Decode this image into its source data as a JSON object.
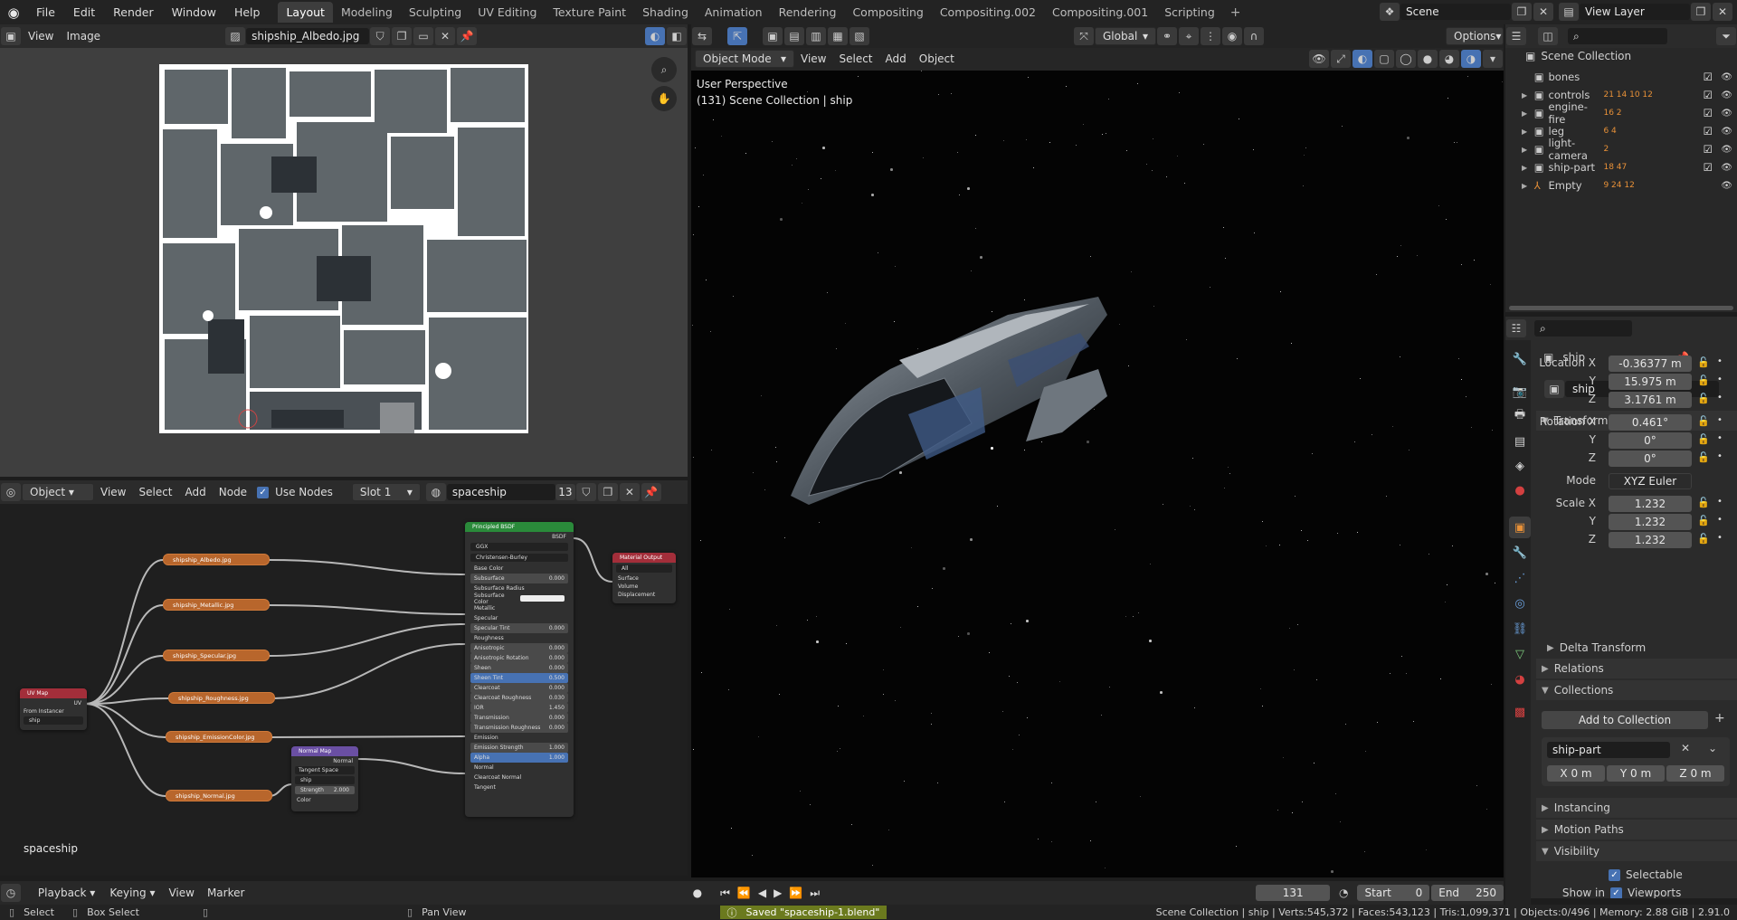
{
  "topbar": {
    "menus": [
      "File",
      "Edit",
      "Render",
      "Window",
      "Help"
    ],
    "workspaces": [
      "Layout",
      "Modeling",
      "Sculpting",
      "UV Editing",
      "Texture Paint",
      "Shading",
      "Animation",
      "Rendering",
      "Compositing",
      "Compositing.002",
      "Compositing.001",
      "Scripting"
    ],
    "active_workspace": "Layout",
    "scene": "Scene",
    "view_layer": "View Layer"
  },
  "image_editor": {
    "menus": [
      "View",
      "Image"
    ],
    "image_name": "shipship_Albedo.jpg"
  },
  "node_editor": {
    "object_type": "Object",
    "menus": [
      "View",
      "Select",
      "Add",
      "Node"
    ],
    "use_nodes_label": "Use Nodes",
    "slot": "Slot 1",
    "material": "spaceship",
    "user_count": "13",
    "footer_label": "spaceship",
    "textures": [
      "shipship_Albedo.jpg",
      "shipship_Metallic.jpg",
      "shipship_Specular.jpg",
      "shipship_Roughness.jpg",
      "shipship_EmissionColor.jpg",
      "shipship_Normal.jpg"
    ],
    "uvmap": {
      "title": "UV Map",
      "out": "UV",
      "from_instancer": "From Instancer",
      "map": "ship"
    },
    "normalmap": {
      "title": "Normal Map",
      "out": "Normal",
      "space": "Tangent Space",
      "map": "ship",
      "strength_label": "Strength",
      "strength": "2.000",
      "color": "Color"
    },
    "bsdf": {
      "title": "Principled BSDF",
      "out": "BSDF",
      "dist": "GGX",
      "sss": "Christensen-Burley",
      "rows": [
        [
          "Base Color",
          ""
        ],
        [
          "Subsurface",
          "0.000"
        ],
        [
          "Subsurface Radius",
          ""
        ],
        [
          "Subsurface Color",
          ""
        ],
        [
          "Metallic",
          ""
        ],
        [
          "Specular",
          ""
        ],
        [
          "Specular Tint",
          "0.000"
        ],
        [
          "Roughness",
          ""
        ],
        [
          "Anisotropic",
          "0.000"
        ],
        [
          "Anisotropic Rotation",
          "0.000"
        ],
        [
          "Sheen",
          "0.000"
        ],
        [
          "Sheen Tint",
          "0.500"
        ],
        [
          "Clearcoat",
          "0.000"
        ],
        [
          "Clearcoat Roughness",
          "0.030"
        ],
        [
          "IOR",
          "1.450"
        ],
        [
          "Transmission",
          "0.000"
        ],
        [
          "Transmission Roughness",
          "0.000"
        ],
        [
          "Emission",
          ""
        ],
        [
          "Emission Strength",
          "1.000"
        ],
        [
          "Alpha",
          "1.000"
        ],
        [
          "Normal",
          ""
        ],
        [
          "Clearcoat Normal",
          ""
        ],
        [
          "Tangent",
          ""
        ]
      ]
    },
    "output": {
      "title": "Material Output",
      "target": "All",
      "rows": [
        "Surface",
        "Volume",
        "Displacement"
      ]
    }
  },
  "viewport": {
    "mode": "Object Mode",
    "menus": [
      "View",
      "Select",
      "Add",
      "Object"
    ],
    "orientation": "Global",
    "options": "Options",
    "overlay_title": "User Perspective",
    "overlay_sub": "(131) Scene Collection | ship"
  },
  "outliner": {
    "root": "Scene Collection",
    "items": [
      {
        "name": "bones",
        "badges": ""
      },
      {
        "name": "controls",
        "badges": "21 14 10 12"
      },
      {
        "name": "engine-fire",
        "badges": "16 2"
      },
      {
        "name": "leg",
        "badges": "6 4"
      },
      {
        "name": "light-camera",
        "badges": "2"
      },
      {
        "name": "ship-part",
        "badges": "18 47"
      },
      {
        "name": "Empty",
        "badges": "9 24 12"
      }
    ]
  },
  "properties": {
    "object_name": "ship",
    "data_name": "ship",
    "transform_label": "Transform",
    "location": {
      "label": "Location X",
      "x": "-0.36377 m",
      "y": "15.975 m",
      "z": "3.1761 m"
    },
    "rotation": {
      "label": "Rotation X",
      "x": "0.461°",
      "y": "0°",
      "z": "0°"
    },
    "mode_label": "Mode",
    "mode": "XYZ Euler",
    "scale": {
      "label": "Scale X",
      "x": "1.232",
      "y": "1.232",
      "z": "1.232"
    },
    "axis_y": "Y",
    "axis_z": "Z",
    "delta": "Delta Transform",
    "relations": "Relations",
    "collections": "Collections",
    "add_to_collection": "Add to Collection",
    "collection_name": "ship-part",
    "offset": {
      "x": "X   0 m",
      "y": "Y   0 m",
      "z": "Z   0 m"
    },
    "instancing": "Instancing",
    "motion_paths": "Motion Paths",
    "visibility": "Visibility",
    "selectable": "Selectable",
    "show_in": "Show in",
    "viewports": "Viewports"
  },
  "timeline": {
    "menus": [
      "Playback",
      "Keying",
      "View",
      "Marker"
    ],
    "frame": "131",
    "start_label": "Start",
    "start": "0",
    "end_label": "End",
    "end": "250"
  },
  "statusbar": {
    "select": "Select",
    "box_select": "Box Select",
    "pan_view": "Pan View",
    "saved": "Saved \"spaceship-1.blend\"",
    "stats": "Scene Collection | ship | Verts:545,372 | Faces:543,123 | Tris:1,099,371 | Objects:0/496 | Memory: 2.88 GiB | 2.91.0"
  },
  "colors": {
    "accent": "#4772b3",
    "active_tab": "#3d3d3d",
    "texture_node": "#b8662c",
    "bsdf_header": "#2a8a3a",
    "output_header": "#a32e3a",
    "uvmap_header": "#a32e3a",
    "normalmap_header": "#6a4fa3",
    "saved_bg": "#6b7a1e"
  }
}
